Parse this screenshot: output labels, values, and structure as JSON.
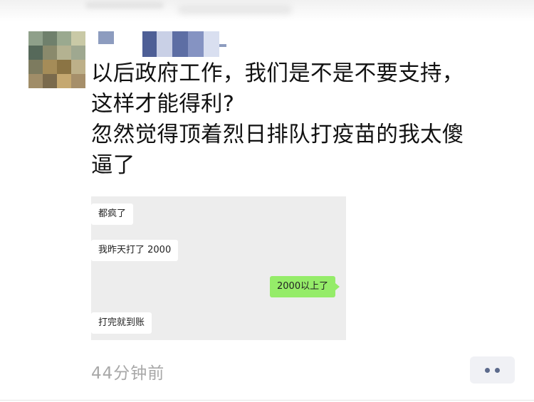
{
  "post": {
    "text": "以后政府工作，我们是不是不要支持，\n这样才能得利?\n忽然觉得顶着烈日排队打疫苗的我太傻\n逼了",
    "timestamp": "44分钟前"
  },
  "chat_screenshot": {
    "messages": [
      {
        "from": "other",
        "text": "都疯了"
      },
      {
        "from": "other",
        "text": "我昨天打了 2000"
      },
      {
        "from": "me",
        "text": "2000以上了"
      },
      {
        "from": "other",
        "text": "打完就到账"
      }
    ]
  },
  "colors": {
    "text": "#111111",
    "timestamp": "#a8a8a8",
    "chat_background": "#ededed",
    "my_bubble": "#95ec69",
    "more_dots": "#5c6a8c"
  },
  "icons": {
    "more": "more-dots-icon"
  }
}
